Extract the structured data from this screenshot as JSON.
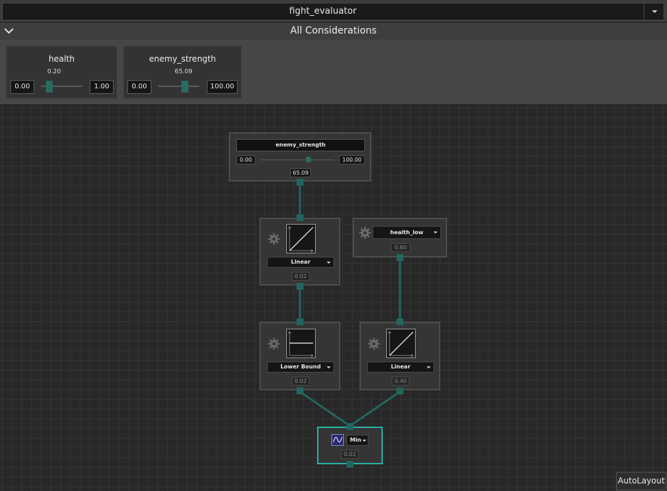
{
  "window": {
    "title": "fight_evaluator"
  },
  "considerations": {
    "header": "All Considerations",
    "cards": [
      {
        "name": "health",
        "min": "0.00",
        "max": "1.00",
        "value": "0.20",
        "fraction": 0.2
      },
      {
        "name": "enemy_strength",
        "min": "0.00",
        "max": "100.00",
        "value": "65.09",
        "fraction": 0.6509
      }
    ]
  },
  "nodes": {
    "input": {
      "label": "enemy_strength",
      "min": "0.00",
      "max": "100.00",
      "value": "65.09",
      "fraction": 0.6509
    },
    "curve1": {
      "type": "Linear",
      "output": "0.02"
    },
    "constant": {
      "label": "health_low",
      "output": "0.60"
    },
    "curve2": {
      "type": "Lower Bound",
      "output": "0.02"
    },
    "curve3": {
      "type": "Linear",
      "output": "0.40"
    },
    "combine": {
      "op": "Min",
      "output": "0.02"
    }
  },
  "toolbar": {
    "autolayout_label": "AutoLayout"
  },
  "colors": {
    "accent": "#27b3a6",
    "port": "#23665f",
    "slider_thumb": "#2a6a62"
  }
}
